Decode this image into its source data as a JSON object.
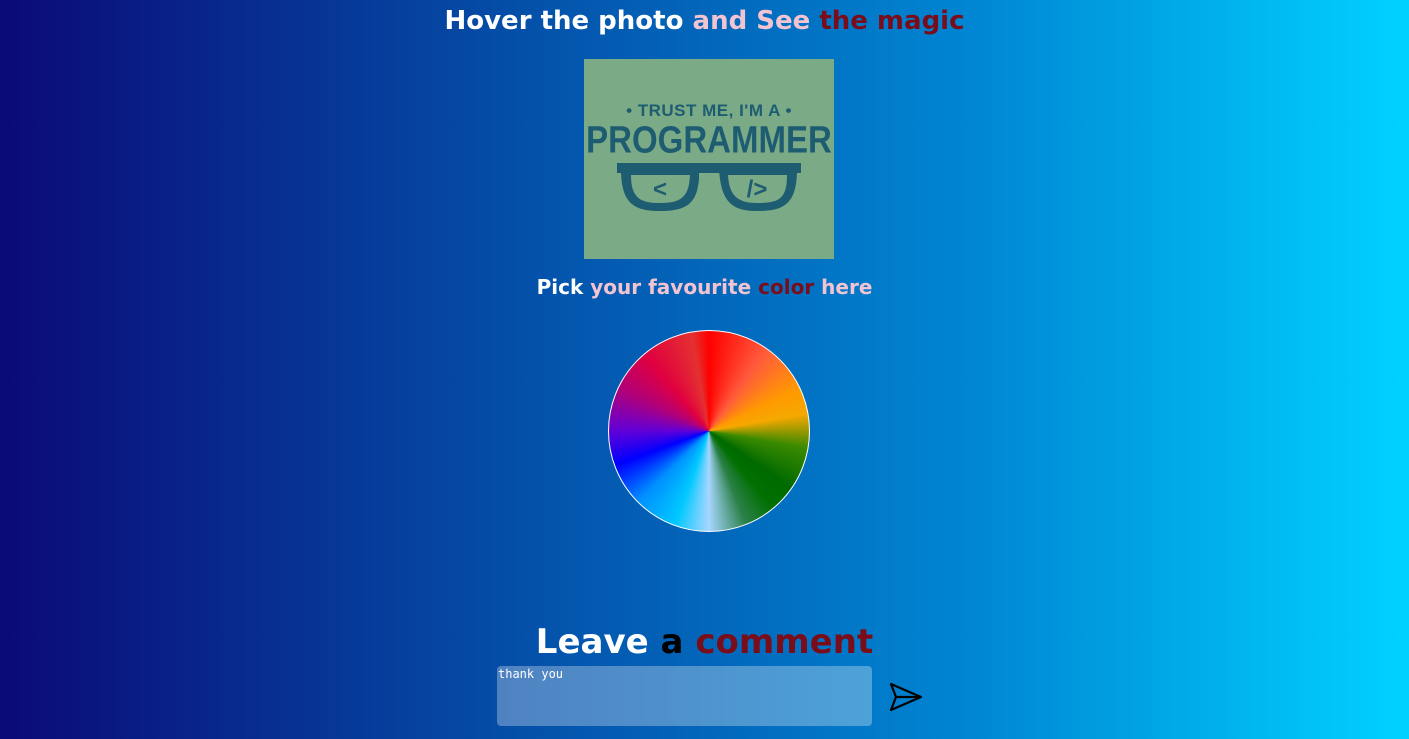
{
  "header": {
    "w1": "Hover the photo",
    "w2": "and See",
    "w3": "the magic"
  },
  "photo": {
    "line1": "• TRUST ME, I'M A •",
    "line2": "PROGRAMMER",
    "lens_left": "<",
    "lens_right": "/>"
  },
  "picker_heading": {
    "w1": "Pick",
    "w2": "your favourite",
    "w3": "color",
    "w4": "here"
  },
  "comment_heading": {
    "w1": "Leave",
    "w2": "a",
    "w3": "comment"
  },
  "comment": {
    "value": "thank you"
  },
  "icons": {
    "send": "paper-plane-icon"
  },
  "colors": {
    "photo_bg": "#7aaa86",
    "accent_red": "#7a0d1a",
    "accent_pink": "#f2c4d2"
  }
}
